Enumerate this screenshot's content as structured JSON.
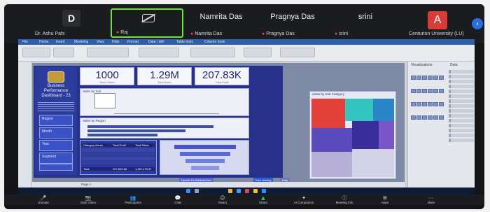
{
  "participants": [
    {
      "initial": "D",
      "name": "Dr. Ashu Pahi",
      "muted": false
    },
    {
      "name": "Raj",
      "muted": true,
      "active_speaker": true
    },
    {
      "big_name": "Namrita Das",
      "name": "Namrita Das",
      "muted": true
    },
    {
      "big_name": "Pragnya Das",
      "name": "Pragnya Das",
      "muted": true
    },
    {
      "big_name": "srini",
      "name": "srini",
      "muted": true
    },
    {
      "initial": "A",
      "name": "Centurion University (LU)",
      "muted": false
    }
  ],
  "shared_app": {
    "ribbon_tabs": [
      "File",
      "Home",
      "Insert",
      "Modeling",
      "View",
      "Help",
      "Format",
      "Data / drill",
      "Table tools",
      "Column tools"
    ],
    "dashboard": {
      "title_line1": "Business",
      "title_line2": "Performance",
      "title_line3": "Dashboard - 23",
      "kpis": [
        {
          "value": "1000",
          "label": "Total Orders"
        },
        {
          "value": "1.29M",
          "label": "Total Sales"
        },
        {
          "value": "207.83K",
          "label": "Total Profit"
        }
      ],
      "slicers": [
        "Region",
        "Month",
        "Year",
        "Segment"
      ],
      "panel_sales_by_sub": "Sales by Sub",
      "panel_sales_by_region": "Sales by Region",
      "panel_treemap": "Sales by Sub Category",
      "table_headers": [
        "Category Name",
        "Total Profit",
        "Total Sales"
      ],
      "table_total": "Total",
      "table_total_profit": "207,826.68",
      "table_total_sales": "1,287,475.37"
    },
    "panes": {
      "visualizations": "Visualizations",
      "data": "Data",
      "search": "Search"
    },
    "status_pills": [
      "Update Ex-Ed/AutoCom",
      "Now viewing",
      "Help"
    ],
    "page_tab": "Page 1"
  },
  "meeting_controls": [
    {
      "icon": "mic-icon",
      "glyph": "🎤",
      "label": "Unmute"
    },
    {
      "icon": "camera-icon",
      "glyph": "📷",
      "label": "Start Video"
    },
    {
      "icon": "people-icon",
      "glyph": "👥",
      "label": "Participants"
    },
    {
      "icon": "chat-icon",
      "glyph": "💬",
      "label": "Chat"
    },
    {
      "icon": "react-icon",
      "glyph": "☺",
      "label": "React"
    },
    {
      "icon": "share-icon",
      "glyph": "▲",
      "label": "Share"
    },
    {
      "icon": "ai-icon",
      "glyph": "✦",
      "label": "AI Companion"
    },
    {
      "icon": "info-icon",
      "glyph": "ⓘ",
      "label": "Meeting Info"
    },
    {
      "icon": "apps-icon",
      "glyph": "⊞",
      "label": "Apps"
    },
    {
      "icon": "more-icon",
      "glyph": "⋯",
      "label": "More"
    }
  ],
  "colors": {
    "dashboard_bg": "#27318a",
    "active_speaker_border": "#6ee33a",
    "avatar_red": "#d93b36"
  }
}
